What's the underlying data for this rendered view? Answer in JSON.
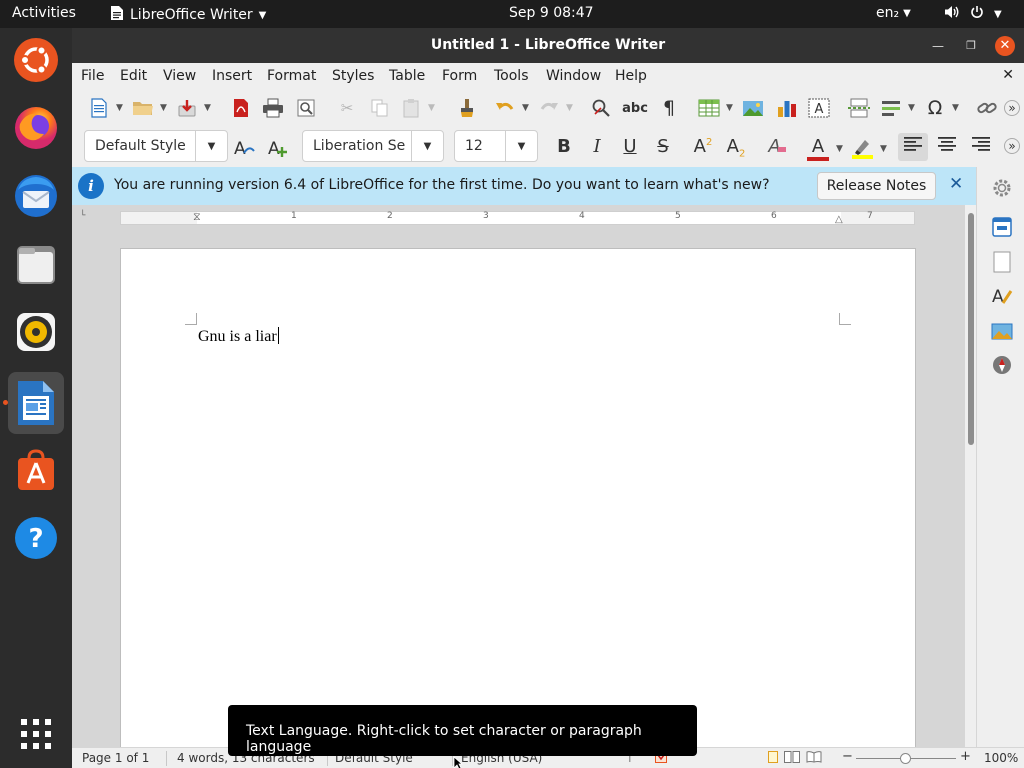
{
  "topbar": {
    "activities": "Activities",
    "app_name": "LibreOffice Writer",
    "clock": "Sep 9  08:47",
    "lang": "en₂"
  },
  "dock": [
    {
      "name": "ubuntu-icon"
    },
    {
      "name": "firefox-icon"
    },
    {
      "name": "thunderbird-icon"
    },
    {
      "name": "files-icon"
    },
    {
      "name": "rhythmbox-icon"
    },
    {
      "name": "writer-icon"
    },
    {
      "name": "software-icon"
    },
    {
      "name": "help-icon"
    },
    {
      "name": "app-grid-icon"
    }
  ],
  "window": {
    "title": "Untitled 1 - LibreOffice Writer"
  },
  "menu": [
    "File",
    "Edit",
    "View",
    "Insert",
    "Format",
    "Styles",
    "Table",
    "Form",
    "Tools",
    "Window",
    "Help"
  ],
  "format_toolbar": {
    "para_style": "Default Style",
    "font_name": "Liberation Se",
    "font_size": "12"
  },
  "infobar": {
    "message": "You are running version 6.4 of LibreOffice for the first time. Do you want to learn what's new?",
    "button": "Release Notes"
  },
  "ruler_numbers": [
    "1",
    "2",
    "3",
    "4",
    "5",
    "6",
    "7"
  ],
  "document": {
    "text": "Gnu is a liar"
  },
  "tooltip": "Text Language. Right-click to set character or paragraph language",
  "status": {
    "page": "Page 1 of 1",
    "words": "4 words, 13 characters",
    "style": "Default Style",
    "language": "English (USA)",
    "zoom": "100%"
  },
  "colors": {
    "accent": "#e95420",
    "info_bg": "#bde5f8",
    "font_color": "#c9211e",
    "highlight": "#ffff00"
  }
}
